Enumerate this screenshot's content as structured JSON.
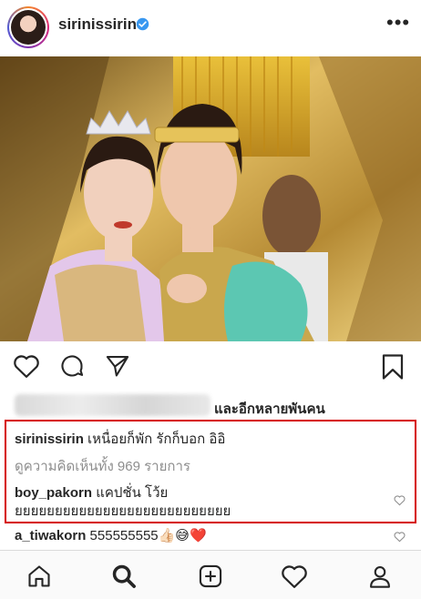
{
  "post": {
    "username": "sirinissirin",
    "more_glyph": "•••",
    "likes_suffix": "และอีกหลายพันคน",
    "caption_user": "sirinissirin",
    "caption_text": " เหนื่อยก็พัก รักก็บอก อิอิ",
    "view_all_comments": "ดูความคิดเห็นทั้ง 969 รายการ",
    "comments": [
      {
        "user": "boy_pakorn",
        "text": " แคปชั่น โว้ยยยยยยยยยยยยยยยยยยยยยยยยยยยย"
      },
      {
        "user": "a_tiwakorn",
        "text": " 555555555",
        "emoji": "👍🏻😅❤️"
      }
    ]
  },
  "icons": {
    "verified": "verified-badge-icon",
    "like": "heart-icon",
    "comment": "comment-icon",
    "share": "send-icon",
    "save": "bookmark-icon",
    "nav": [
      "home-icon",
      "search-icon",
      "new-post-icon",
      "activity-heart-icon",
      "profile-icon"
    ]
  },
  "colors": {
    "highlight_box": "#d60000",
    "verified": "#3897f0",
    "muted_text": "#8e8e8e"
  }
}
